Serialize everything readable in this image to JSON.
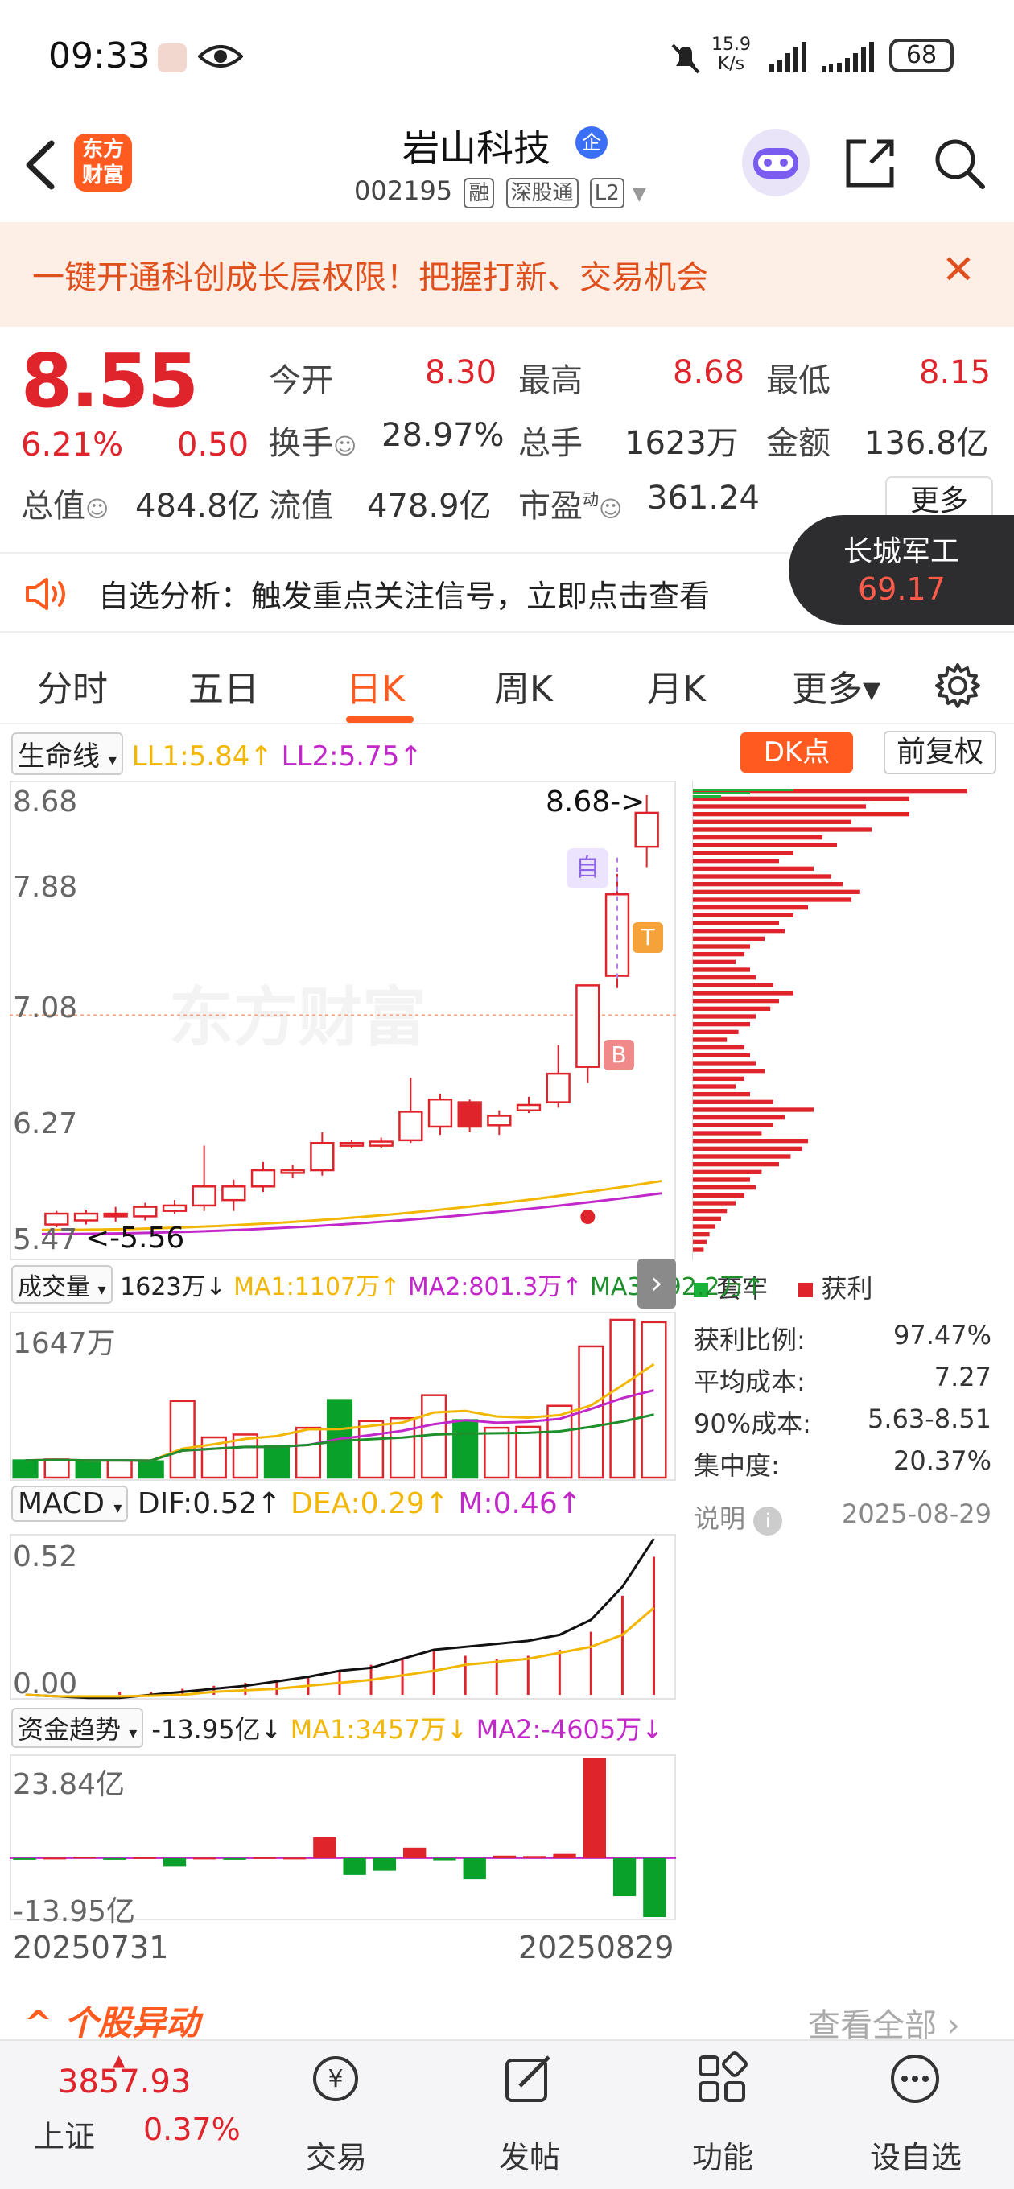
{
  "status_bar": {
    "time": "09:33",
    "net_speed_value": "15.9",
    "net_speed_unit": "K/s",
    "battery": "68"
  },
  "header": {
    "logo_text_line1": "东方",
    "logo_text_line2": "财富",
    "stock_name": "岩山科技",
    "badge": "企",
    "stock_code": "002195",
    "tags": [
      "融",
      "深股通",
      "L2"
    ]
  },
  "banner": {
    "text": "一键开通科创成长层权限！把握打新、交易机会",
    "close": "✕"
  },
  "quote": {
    "price": "8.55",
    "change_pct": "6.21%",
    "change": "0.50",
    "open_label": "今开",
    "open": "8.30",
    "high_label": "最高",
    "high": "8.68",
    "low_label": "最低",
    "low": "8.15",
    "turnover_label": "换手",
    "turnover": "28.97%",
    "volume_label": "总手",
    "volume": "1623万",
    "amount_label": "金额",
    "amount": "136.8亿",
    "mcap_label": "总值",
    "mcap": "484.8亿",
    "float_label": "流值",
    "float_cap": "478.9亿",
    "pe_label": "市盈",
    "pe_sup": "动",
    "pe": "361.24",
    "more": "更多"
  },
  "analysis": {
    "text": "自选分析：触发重点关注信号，立即点击查看",
    "float_name": "长城军工",
    "float_value": "69.17"
  },
  "tabs": [
    "分时",
    "五日",
    "日K",
    "周K",
    "月K",
    "更多▾"
  ],
  "active_tab": 2,
  "kline": {
    "indicator": "生命线",
    "ll1": "LL1:5.84↑",
    "ll2": "LL2:5.75↑",
    "dk": "DK点",
    "adjust": "前复权",
    "axis_labels": [
      "8.68",
      "7.88",
      "7.08",
      "6.27",
      "5.47"
    ],
    "high_marker": "8.68->",
    "low_marker": "<-5.56",
    "watermark": "东方财富",
    "marker_zi": "自",
    "marker_t": "T",
    "marker_b": "B"
  },
  "volume": {
    "indicator": "成交量",
    "val": "1623万↓",
    "ma1": "MA1:1107万↑",
    "ma2": "MA2:801.3万↑",
    "ma3": "MA3:592.2万↑",
    "axis_top": "1647万"
  },
  "macd": {
    "indicator": "MACD",
    "dif": "DIF:0.52↑",
    "dea": "DEA:0.29↑",
    "m": "M:0.46↑",
    "axis_top": "0.52",
    "axis_bottom": "0.00"
  },
  "fund": {
    "indicator": "资金趋势",
    "val": "-13.95亿↓",
    "ma1": "MA1:3457万↓",
    "ma2": "MA2:-4605万↓",
    "axis_top": "23.84亿",
    "axis_bottom": "-13.95亿"
  },
  "dates": {
    "start": "20250731",
    "end": "20250829"
  },
  "chips": {
    "legend_trapped": "套牢",
    "legend_profit": "获利",
    "rows": [
      {
        "label": "获利比例:",
        "value": "97.47%"
      },
      {
        "label": "平均成本:",
        "value": "7.27"
      },
      {
        "label": "90%成本:",
        "value": "5.63-8.51"
      },
      {
        "label": "集中度:",
        "value": "20.37%"
      }
    ],
    "note": "说明",
    "date": "2025-08-29"
  },
  "movement": {
    "title": "个股异动",
    "view_all": "查看全部"
  },
  "bottom_nav": {
    "index_value": "3857.93",
    "index_name": "上证",
    "index_change": "0.37%",
    "items": [
      "交易",
      "发帖",
      "功能",
      "设自选"
    ]
  },
  "colors": {
    "up": "#e0242b",
    "down": "#0aa12a",
    "accent": "#ff5a1f",
    "ma_yellow": "#f2b705",
    "ma_purple": "#c228c9",
    "ma_green": "#1f8f2c"
  },
  "chart_data": {
    "type": "candlestick",
    "x_start": "20250731",
    "x_end": "20250829",
    "y_range": [
      5.47,
      8.68
    ],
    "candles": [
      {
        "o": 5.52,
        "c": 5.6,
        "h": 5.62,
        "l": 5.5
      },
      {
        "o": 5.55,
        "c": 5.6,
        "h": 5.63,
        "l": 5.52
      },
      {
        "o": 5.6,
        "c": 5.58,
        "h": 5.65,
        "l": 5.54
      },
      {
        "o": 5.58,
        "c": 5.65,
        "h": 5.68,
        "l": 5.55
      },
      {
        "o": 5.62,
        "c": 5.66,
        "h": 5.7,
        "l": 5.6
      },
      {
        "o": 5.66,
        "c": 5.8,
        "h": 6.1,
        "l": 5.62
      },
      {
        "o": 5.7,
        "c": 5.8,
        "h": 5.85,
        "l": 5.62
      },
      {
        "o": 5.8,
        "c": 5.92,
        "h": 5.98,
        "l": 5.76
      },
      {
        "o": 5.9,
        "c": 5.92,
        "h": 5.96,
        "l": 5.86
      },
      {
        "o": 5.92,
        "c": 6.12,
        "h": 6.2,
        "l": 5.88
      },
      {
        "o": 6.1,
        "c": 6.12,
        "h": 6.14,
        "l": 6.08
      },
      {
        "o": 6.1,
        "c": 6.13,
        "h": 6.16,
        "l": 6.08
      },
      {
        "o": 6.14,
        "c": 6.35,
        "h": 6.6,
        "l": 6.12
      },
      {
        "o": 6.24,
        "c": 6.44,
        "h": 6.48,
        "l": 6.18
      },
      {
        "o": 6.42,
        "c": 6.24,
        "h": 6.44,
        "l": 6.2
      },
      {
        "o": 6.25,
        "c": 6.32,
        "h": 6.36,
        "l": 6.18
      },
      {
        "o": 6.36,
        "c": 6.4,
        "h": 6.46,
        "l": 6.34
      },
      {
        "o": 6.42,
        "c": 6.63,
        "h": 6.84,
        "l": 6.38
      },
      {
        "o": 6.68,
        "c": 7.28,
        "h": 7.28,
        "l": 6.56
      },
      {
        "o": 7.35,
        "c": 7.95,
        "h": 8.1,
        "l": 7.26
      },
      {
        "o": 8.3,
        "c": 8.55,
        "h": 8.68,
        "l": 8.15
      }
    ],
    "volume_axis_top": 1647,
    "volumes": [
      180,
      190,
      170,
      180,
      170,
      800,
      420,
      450,
      330,
      520,
      810,
      590,
      620,
      860,
      600,
      520,
      530,
      750,
      1370,
      1647,
      1623
    ],
    "volume_up": [
      false,
      true,
      false,
      true,
      false,
      true,
      true,
      true,
      false,
      true,
      false,
      true,
      true,
      true,
      false,
      true,
      true,
      true,
      true,
      true,
      true
    ],
    "macd_dif": [
      0.0,
      -0.005,
      -0.01,
      -0.01,
      0.0,
      0.01,
      0.02,
      0.03,
      0.045,
      0.06,
      0.08,
      0.09,
      0.12,
      0.15,
      0.16,
      0.17,
      0.18,
      0.2,
      0.25,
      0.36,
      0.52
    ],
    "macd_dea": [
      0.0,
      -0.005,
      -0.005,
      -0.005,
      -0.003,
      0.0,
      0.01,
      0.015,
      0.02,
      0.03,
      0.04,
      0.05,
      0.065,
      0.08,
      0.1,
      0.11,
      0.12,
      0.14,
      0.16,
      0.2,
      0.29
    ],
    "macd_bar": [
      0.0,
      0.0,
      0.0,
      0.01,
      0.01,
      0.02,
      0.03,
      0.04,
      0.05,
      0.06,
      0.08,
      0.1,
      0.12,
      0.15,
      0.13,
      0.12,
      0.13,
      0.15,
      0.21,
      0.33,
      0.46
    ],
    "fund_flow": [
      -0.2,
      0.1,
      0.3,
      -0.1,
      0.2,
      -2.0,
      0.1,
      -0.2,
      0.2,
      0.1,
      5.0,
      -4.0,
      -3.0,
      2.5,
      -0.5,
      -5.0,
      0.6,
      0.5,
      1.0,
      23.84,
      -9.0,
      -13.95
    ],
    "chip_profit": [
      0.95,
      0.75,
      0.6,
      0.75,
      0.55,
      0.62,
      0.45,
      0.5,
      0.35,
      0.3,
      0.42,
      0.48,
      0.52,
      0.58,
      0.55,
      0.4,
      0.35,
      0.3,
      0.32,
      0.25,
      0.2,
      0.18,
      0.15,
      0.2,
      0.22,
      0.28,
      0.35,
      0.3,
      0.27,
      0.22,
      0.2,
      0.16,
      0.12,
      0.18,
      0.2,
      0.22,
      0.25,
      0.18,
      0.15,
      0.2,
      0.28,
      0.42,
      0.32,
      0.28,
      0.24,
      0.4,
      0.38,
      0.34,
      0.3,
      0.24,
      0.2,
      0.22,
      0.18,
      0.15,
      0.12,
      0.1,
      0.08,
      0.06,
      0.05,
      0.04
    ],
    "chip_trapped": [
      0.35,
      0.2,
      0.1
    ]
  }
}
